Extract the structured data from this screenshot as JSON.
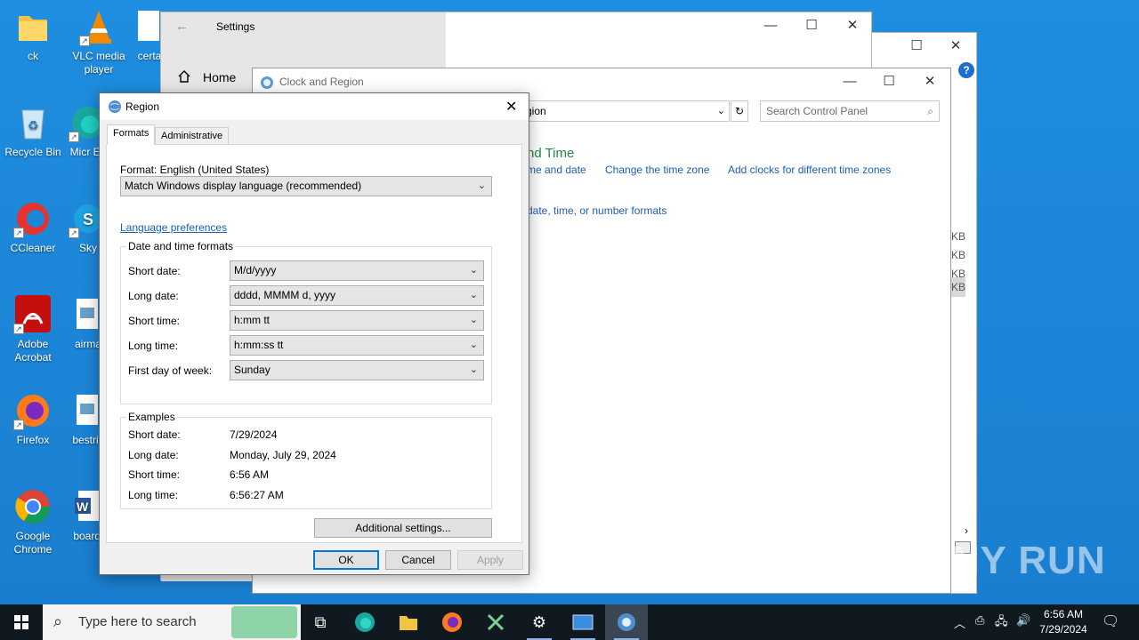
{
  "desktop": {
    "icons": [
      {
        "label": "ck"
      },
      {
        "label": "VLC media player"
      },
      {
        "label": "certa"
      },
      {
        "label": "Recycle Bin"
      },
      {
        "label": "Micr Ed"
      },
      {
        "label": "CCleaner"
      },
      {
        "label": "Sky"
      },
      {
        "label": "Adobe Acrobat"
      },
      {
        "label": "airma"
      },
      {
        "label": "Firefox"
      },
      {
        "label": "bestriv"
      },
      {
        "label": "Google Chrome"
      },
      {
        "label": "boardi"
      }
    ]
  },
  "settings_window": {
    "title": "Settings",
    "home_label": "Home",
    "back_icon": "arrow-left-icon"
  },
  "control_panel": {
    "title": "Clock and Region",
    "address_text": "gion",
    "search_placeholder": "Search Control Panel",
    "section_heading": "nd Time",
    "links": {
      "set_time": "me and date",
      "change_timezone": "Change the time zone",
      "add_clocks": "Add clocks for different time zones",
      "formats": "date, time, or number formats"
    },
    "side_items": [
      "KB",
      "KB",
      "KB",
      "KB"
    ]
  },
  "region_dialog": {
    "title": "Region",
    "tabs": [
      {
        "label": "Formats",
        "active": true
      },
      {
        "label": "Administrative",
        "active": false
      }
    ],
    "format_label": "Format: English (United States)",
    "format_value": "Match Windows display language (recommended)",
    "language_prefs_link": "Language preferences",
    "date_time_group": {
      "title": "Date and time formats",
      "rows": [
        {
          "label": "Short date:",
          "value": "M/d/yyyy"
        },
        {
          "label": "Long date:",
          "value": "dddd, MMMM d, yyyy"
        },
        {
          "label": "Short time:",
          "value": "h:mm tt"
        },
        {
          "label": "Long time:",
          "value": "h:mm:ss tt"
        },
        {
          "label": "First day of week:",
          "value": "Sunday"
        }
      ]
    },
    "examples_group": {
      "title": "Examples",
      "rows": [
        {
          "label": "Short date:",
          "value": "7/29/2024"
        },
        {
          "label": "Long date:",
          "value": "Monday, July 29, 2024"
        },
        {
          "label": "Short time:",
          "value": "6:56 AM"
        },
        {
          "label": "Long time:",
          "value": "6:56:27 AM"
        }
      ]
    },
    "additional_settings": "Additional settings...",
    "ok": "OK",
    "cancel": "Cancel",
    "apply": "Apply"
  },
  "taskbar": {
    "search_placeholder": "Type here to search",
    "time": "6:56 AM",
    "date": "7/29/2024"
  },
  "watermark": "ANY RUN",
  "colors": {
    "desktop": "#1a86d8",
    "link": "#1c5fb8",
    "heading_green": "#20894b",
    "accent": "#0078d7"
  }
}
